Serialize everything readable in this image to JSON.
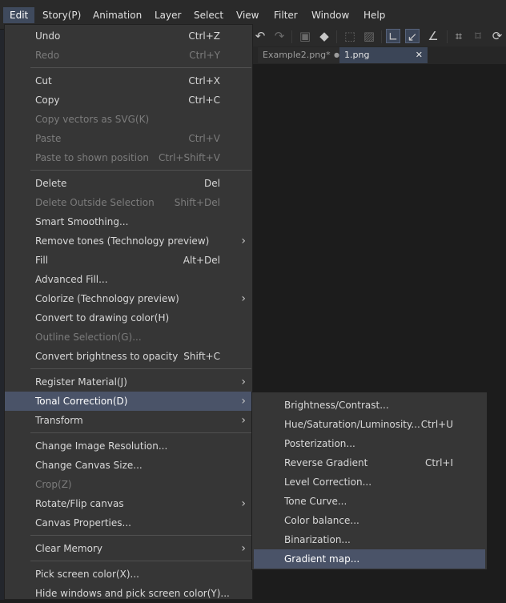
{
  "menubar": {
    "items": [
      {
        "label": "Edit",
        "active": true
      },
      {
        "label": "Story(P)"
      },
      {
        "label": "Animation"
      },
      {
        "label": "Layer"
      },
      {
        "label": "Select"
      },
      {
        "label": "View"
      },
      {
        "label": "Filter"
      },
      {
        "label": "Window"
      },
      {
        "label": "Help"
      }
    ]
  },
  "toolbar": {
    "icons": [
      "undo-icon",
      "redo-icon",
      "fill-clear-icon",
      "bucket-icon",
      "clear-selection-icon",
      "invert-selection-icon",
      "snap-ruler-icon",
      "snap-curve-icon",
      "snap-special-icon",
      "transform-icon",
      "crop-icon",
      "rotate-icon"
    ]
  },
  "tabs": [
    {
      "label": "Example2.png*",
      "modified_mark": "●"
    },
    {
      "label": "1.png",
      "close": "✕"
    }
  ],
  "edit_menu": {
    "items": [
      {
        "label": "Undo",
        "shortcut": "Ctrl+Z"
      },
      {
        "label": "Redo",
        "shortcut": "Ctrl+Y",
        "disabled": true
      },
      {
        "label": "Cut",
        "shortcut": "Ctrl+X"
      },
      {
        "label": "Copy",
        "shortcut": "Ctrl+C"
      },
      {
        "label": "Copy vectors as SVG(K)",
        "shortcut": "",
        "disabled": true
      },
      {
        "label": "Paste",
        "shortcut": "Ctrl+V",
        "disabled": true
      },
      {
        "label": "Paste to shown position",
        "shortcut": "Ctrl+Shift+V",
        "disabled": true
      },
      {
        "label": "Delete",
        "shortcut": "Del"
      },
      {
        "label": "Delete Outside Selection",
        "shortcut": "Shift+Del",
        "disabled": true
      },
      {
        "label": "Smart Smoothing...",
        "shortcut": ""
      },
      {
        "label": "Remove tones (Technology preview)",
        "shortcut": "",
        "submenu": true
      },
      {
        "label": "Fill",
        "shortcut": "Alt+Del"
      },
      {
        "label": "Advanced Fill...",
        "shortcut": ""
      },
      {
        "label": "Colorize (Technology preview)",
        "shortcut": "",
        "submenu": true
      },
      {
        "label": "Convert to drawing color(H)",
        "shortcut": ""
      },
      {
        "label": "Outline Selection(G)...",
        "shortcut": "",
        "disabled": true
      },
      {
        "label": "Convert brightness to opacity",
        "shortcut": "Shift+C"
      },
      {
        "label": "Register Material(J)",
        "shortcut": "",
        "submenu": true
      },
      {
        "label": "Tonal Correction(D)",
        "shortcut": "",
        "submenu": true,
        "highlighted": true
      },
      {
        "label": "Transform",
        "shortcut": "",
        "submenu": true
      },
      {
        "label": "Change Image Resolution...",
        "shortcut": ""
      },
      {
        "label": "Change Canvas Size...",
        "shortcut": ""
      },
      {
        "label": "Crop(Z)",
        "shortcut": "",
        "disabled": true
      },
      {
        "label": "Rotate/Flip canvas",
        "shortcut": "",
        "submenu": true
      },
      {
        "label": "Canvas Properties...",
        "shortcut": ""
      },
      {
        "label": "Clear Memory",
        "shortcut": "",
        "submenu": true
      },
      {
        "label": "Pick screen color(X)...",
        "shortcut": ""
      },
      {
        "label": "Hide windows and pick screen color(Y)...",
        "shortcut": ""
      }
    ],
    "arrow": "›"
  },
  "tonal_submenu": {
    "items": [
      {
        "label": "Brightness/Contrast...",
        "shortcut": ""
      },
      {
        "label": "Hue/Saturation/Luminosity...",
        "shortcut": "Ctrl+U"
      },
      {
        "label": "Posterization...",
        "shortcut": ""
      },
      {
        "label": "Reverse Gradient",
        "shortcut": "Ctrl+I"
      },
      {
        "label": "Level Correction...",
        "shortcut": ""
      },
      {
        "label": "Tone Curve...",
        "shortcut": ""
      },
      {
        "label": "Color balance...",
        "shortcut": ""
      },
      {
        "label": "Binarization...",
        "shortcut": ""
      },
      {
        "label": "Gradient map...",
        "shortcut": "",
        "highlighted": true
      }
    ]
  }
}
